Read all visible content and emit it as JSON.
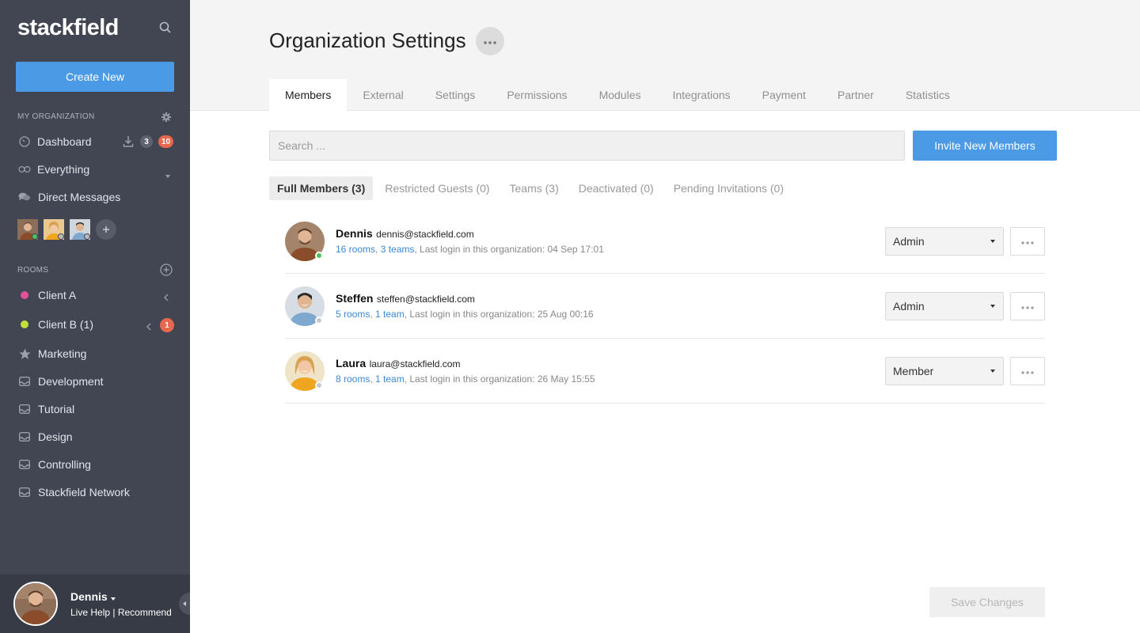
{
  "app": {
    "logo": "stackfield"
  },
  "sidebar": {
    "create_label": "Create New",
    "org_section": "MY ORGANIZATION",
    "nav": {
      "dashboard": {
        "label": "Dashboard",
        "badge_gray": "3",
        "badge_red": "10"
      },
      "everything": {
        "label": "Everything"
      },
      "messages": {
        "label": "Direct Messages"
      }
    },
    "rooms_section": "ROOMS",
    "rooms": [
      {
        "label": "Client A",
        "color": "#e4509a"
      },
      {
        "label": "Client B (1)",
        "color": "#c5dd3c",
        "badge": "1"
      },
      {
        "label": "Marketing"
      },
      {
        "label": "Development"
      },
      {
        "label": "Tutorial"
      },
      {
        "label": "Design"
      },
      {
        "label": "Controlling"
      },
      {
        "label": "Stackfield Network"
      }
    ],
    "user": {
      "name": "Dennis",
      "links": "Live Help | Recommend"
    }
  },
  "header": {
    "title": "Organization Settings",
    "tabs": [
      "Members",
      "External",
      "Settings",
      "Permissions",
      "Modules",
      "Integrations",
      "Payment",
      "Partner",
      "Statistics"
    ]
  },
  "search": {
    "placeholder": "Search ..."
  },
  "invite_label": "Invite New Members",
  "subtabs": [
    "Full Members (3)",
    "Restricted Guests (0)",
    "Teams (3)",
    "Deactivated (0)",
    "Pending Invitations (0)"
  ],
  "members": [
    {
      "name": "Dennis",
      "email": "dennis@stackfield.com",
      "rooms": "16 rooms",
      "teams": "3 teams",
      "login": ", Last login in this organization: 04 Sep 17:01",
      "role": "Admin",
      "status_color": "#4cc25b"
    },
    {
      "name": "Steffen",
      "email": "steffen@stackfield.com",
      "rooms": "5 rooms",
      "teams": "1 team",
      "login": ", Last login in this organization: 25 Aug 00:16",
      "role": "Admin",
      "status_color": "#c8c8c8"
    },
    {
      "name": "Laura",
      "email": "laura@stackfield.com",
      "rooms": "8 rooms",
      "teams": "1 team",
      "login": ", Last login in this organization: 26 May 15:55",
      "role": "Member",
      "status_color": "#c8c8c8"
    }
  ],
  "save_label": "Save Changes"
}
